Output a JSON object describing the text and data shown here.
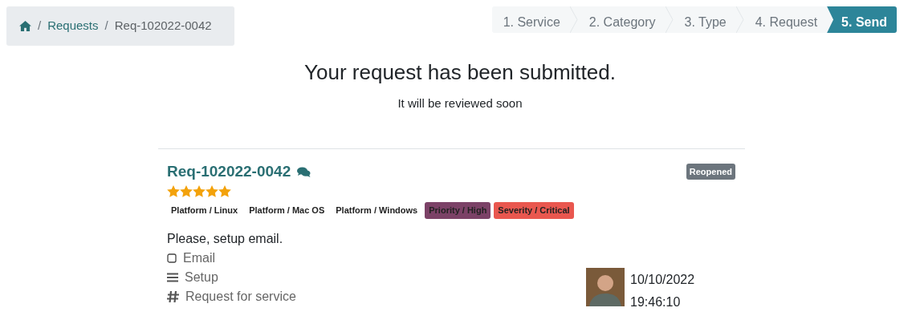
{
  "breadcrumb": [
    {
      "separator": "/",
      "label": "Requests"
    },
    {
      "separator": "/",
      "label": "Req-102022-0042"
    }
  ],
  "steps": [
    {
      "label": "1. Service",
      "selected": false
    },
    {
      "label": "2. Category",
      "selected": false
    },
    {
      "label": "3. Type",
      "selected": false
    },
    {
      "label": "4. Request",
      "selected": false
    },
    {
      "label": "5. Send",
      "selected": true
    }
  ],
  "heading": "Your request has been submitted.",
  "subheading": "It will be reviewed soon",
  "request": {
    "title": "Req-102022-0042",
    "status": "Reopened",
    "stars": 5,
    "tags": [
      {
        "label": "Platform / Linux",
        "color": "#ffffff"
      },
      {
        "label": "Platform / Mac OS",
        "color": "#ffffff"
      },
      {
        "label": "Platform / Windows",
        "color": "#ffffff"
      },
      {
        "label": "Priority / High",
        "color": "#7c4267"
      },
      {
        "label": "Severity / Critical",
        "color": "#e9574f"
      }
    ],
    "description": "Please, setup email.",
    "fields": [
      {
        "kind": "category",
        "value": "Email"
      },
      {
        "kind": "type",
        "value": "Setup"
      },
      {
        "kind": "reference",
        "value": "Request for service"
      }
    ],
    "date": "10/10/2022",
    "time": "19:46:10"
  }
}
